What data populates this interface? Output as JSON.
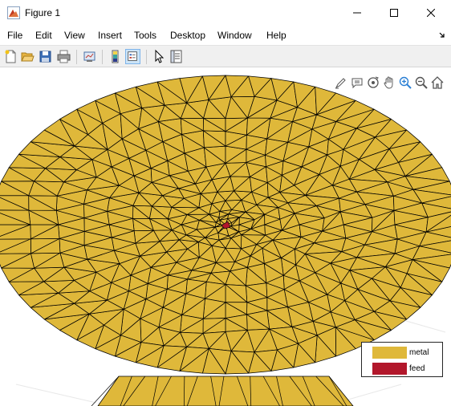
{
  "window": {
    "title": "Figure 1",
    "controls": [
      "minimize-icon",
      "maximize-icon",
      "close-icon"
    ]
  },
  "menu": {
    "items": [
      "File",
      "Edit",
      "View",
      "Insert",
      "Tools",
      "Desktop",
      "Window",
      "Help"
    ]
  },
  "toolbar": {
    "buttons": [
      "new-figure-icon",
      "open-file-icon",
      "save-icon",
      "print-icon",
      "link-plot-icon",
      "insert-colorbar-icon",
      "insert-legend-icon",
      "edit-plot-arrow-icon",
      "property-inspector-icon"
    ]
  },
  "axes_toolbar": {
    "buttons": [
      "brush-icon",
      "data-tips-icon",
      "rotate-3d-icon",
      "pan-hand-icon",
      "zoom-in-icon",
      "zoom-out-icon",
      "home-restore-view-icon"
    ]
  },
  "legend": {
    "entries": [
      {
        "label": "metal",
        "color": "#dfb83a"
      },
      {
        "label": "feed",
        "color": "#b2172b"
      }
    ]
  },
  "colors": {
    "metal": "#dfb83a",
    "feed": "#b2172b",
    "mesh_edge": "#000000",
    "toolbar_bg": "#f0f0f0",
    "axes_background": "#ffffff"
  }
}
